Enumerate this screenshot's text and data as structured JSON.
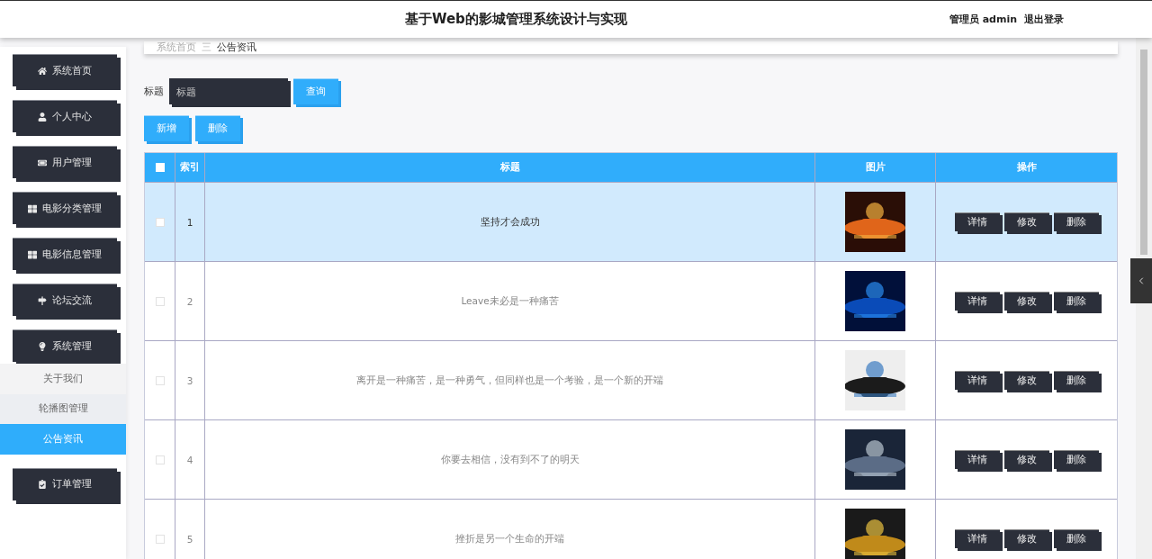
{
  "header": {
    "title": "基于Web的影城管理系统设计与实现",
    "user": "管理员 admin",
    "logout": "退出登录"
  },
  "sidebar": {
    "items": [
      {
        "label": "系统首页"
      },
      {
        "label": "个人中心"
      },
      {
        "label": "用户管理"
      },
      {
        "label": "电影分类管理"
      },
      {
        "label": "电影信息管理"
      },
      {
        "label": "论坛交流"
      },
      {
        "label": "系统管理",
        "children": [
          {
            "label": "关于我们",
            "selected": false
          },
          {
            "label": "轮播图管理",
            "selected": false
          },
          {
            "label": "公告资讯",
            "selected": true
          }
        ]
      },
      {
        "label": "订单管理"
      }
    ]
  },
  "breadcrumb": {
    "home": "系统首页",
    "separator": "三",
    "current": "公告资讯"
  },
  "search": {
    "label": "标题",
    "placeholder": "标题",
    "button": "查询"
  },
  "actions": [
    "新增",
    "删除"
  ],
  "table": {
    "all_checked": false,
    "columns": [
      "索引",
      "标题",
      "图片",
      "操作"
    ],
    "rows": [
      {
        "index": "1",
        "title": "坚持才会成功",
        "highlighted": true,
        "checked": false,
        "buttons": [
          "详情",
          "修改",
          "删除"
        ]
      },
      {
        "index": "2",
        "title": "Leave未必是一种痛苦",
        "highlighted": false,
        "checked": false,
        "buttons": [
          "详情",
          "修改",
          "删除"
        ]
      },
      {
        "index": "3",
        "title": "离开是一种痛苦，是一种勇气，但同样也是一个考验，是一个新的开端",
        "highlighted": false,
        "checked": false,
        "buttons": [
          "详情",
          "修改",
          "删除"
        ]
      },
      {
        "index": "4",
        "title": "你要去相信，没有到不了的明天",
        "highlighted": false,
        "checked": false,
        "buttons": [
          "详情",
          "修改",
          "删除"
        ]
      },
      {
        "index": "5",
        "title": "挫折是另一个生命的开端",
        "highlighted": false,
        "checked": false,
        "buttons": [
          "详情",
          "修改",
          "删除"
        ]
      }
    ]
  }
}
